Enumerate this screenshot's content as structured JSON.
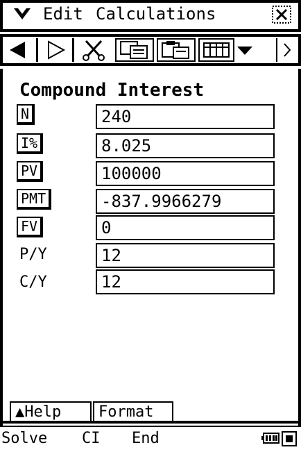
{
  "menubar": {
    "menu_label": "Edit",
    "app_title": "Calculations"
  },
  "toolbar": {
    "icons": [
      "previous-icon",
      "next-icon",
      "cut-icon",
      "copy-icon",
      "paste-icon",
      "grid-icon",
      "dropdown-icon",
      "scroll-right-icon"
    ]
  },
  "main": {
    "title": "Compound Interest",
    "fields": [
      {
        "label": "N",
        "value": "240",
        "boxed": true
      },
      {
        "label": "I%",
        "value": "8.025",
        "boxed": true
      },
      {
        "label": "PV",
        "value": "100000",
        "boxed": true
      },
      {
        "label": "PMT",
        "value": "-837.9966279",
        "boxed": true
      },
      {
        "label": "FV",
        "value": "0",
        "boxed": true
      },
      {
        "label": "P/Y",
        "value": "12",
        "boxed": false
      },
      {
        "label": "C/Y",
        "value": "12",
        "boxed": false
      }
    ]
  },
  "tabs": {
    "help": "▲Help",
    "format": "Format"
  },
  "statusbar": {
    "solve": "Solve",
    "ci": "CI",
    "end": "End"
  },
  "colors": {
    "foreground": "#000000",
    "background": "#ffffff"
  }
}
